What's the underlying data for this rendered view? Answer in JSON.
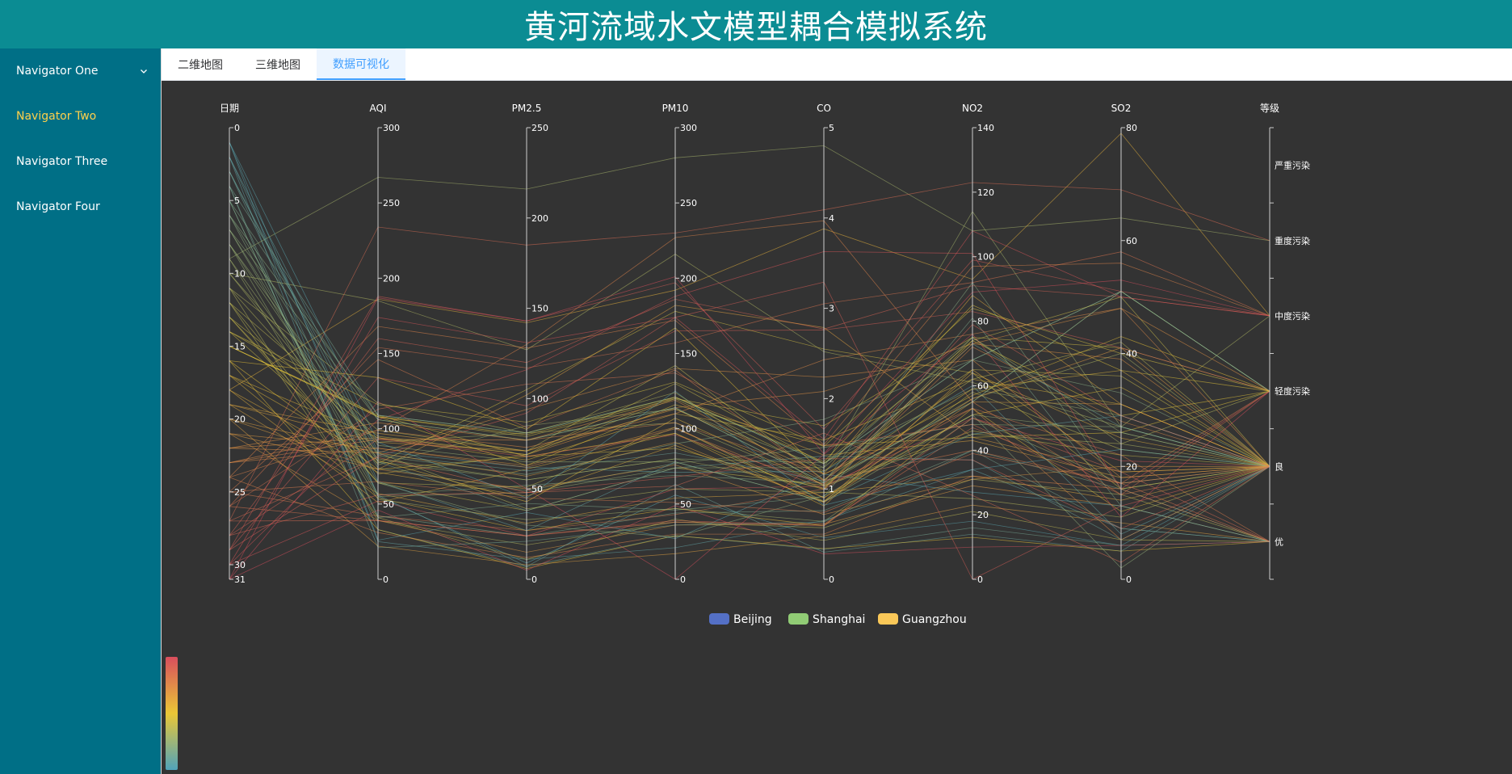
{
  "header": {
    "title": "黄河流域水文模型耦合模拟系统"
  },
  "sidebar": {
    "items": [
      {
        "label": "Navigator One",
        "icon": "chevron-down-icon",
        "active": false
      },
      {
        "label": "Navigator Two",
        "active": true
      },
      {
        "label": "Navigator Three",
        "active": false
      },
      {
        "label": "Navigator Four",
        "active": false
      }
    ]
  },
  "tabs": [
    {
      "label": "二维地图",
      "active": false
    },
    {
      "label": "三维地图",
      "active": false
    },
    {
      "label": "数据可视化",
      "active": true
    }
  ],
  "colors": {
    "header_bg": "#0b8c93",
    "sidebar_bg": "#006f86",
    "active_nav": "#ffd04b",
    "active_tab": "#409eff",
    "chart_bg": "#333333",
    "visualmap": [
      "#50a3ba",
      "#eac736",
      "#d94e5d"
    ]
  },
  "chart_data": {
    "type": "parallel",
    "axes": [
      {
        "name": "日期",
        "type": "value",
        "min": 0,
        "max": 31,
        "ticks": [
          0,
          5,
          10,
          15,
          20,
          25,
          30,
          31
        ],
        "inverse": true
      },
      {
        "name": "AQI",
        "type": "value",
        "min": 0,
        "max": 300,
        "ticks": [
          0,
          50,
          100,
          150,
          200,
          250,
          300
        ]
      },
      {
        "name": "PM2.5",
        "type": "value",
        "min": 0,
        "max": 250,
        "ticks": [
          0,
          50,
          100,
          150,
          200,
          250
        ]
      },
      {
        "name": "PM10",
        "type": "value",
        "min": 0,
        "max": 300,
        "ticks": [
          0,
          50,
          100,
          150,
          200,
          250,
          300
        ]
      },
      {
        "name": "CO",
        "type": "value",
        "min": 0,
        "max": 5,
        "ticks": [
          0,
          1,
          2,
          3,
          4,
          5
        ]
      },
      {
        "name": "NO2",
        "type": "value",
        "min": 0,
        "max": 140,
        "ticks": [
          0,
          20,
          40,
          60,
          80,
          100,
          120,
          140
        ]
      },
      {
        "name": "SO2",
        "type": "value",
        "min": 0,
        "max": 80,
        "ticks": [
          0,
          20,
          40,
          60,
          80
        ]
      },
      {
        "name": "等级",
        "type": "category",
        "categories": [
          "严重污染",
          "重度污染",
          "中度污染",
          "轻度污染",
          "良",
          "优"
        ]
      }
    ],
    "legend": [
      "Beijing",
      "Shanghai",
      "Guangzhou"
    ],
    "legend_colors": [
      "#5470c6",
      "#91cc75",
      "#fac858"
    ],
    "legend_position": "bottom-center",
    "visual_map": {
      "dimension": "日期",
      "min": 0,
      "max": 31,
      "colors": [
        "#50a3ba",
        "#eac736",
        "#d94e5d"
      ],
      "position": "bottom-left"
    },
    "series": [
      {
        "name": "Beijing",
        "data": [
          [
            1,
            55,
            9,
            56,
            0.46,
            18,
            6,
            "良"
          ],
          [
            2,
            25,
            11,
            21,
            0.65,
            34,
            9,
            "优"
          ],
          [
            3,
            56,
            7,
            63,
            0.3,
            14,
            5,
            "良"
          ],
          [
            4,
            33,
            7,
            29,
            0.33,
            16,
            6,
            "优"
          ],
          [
            5,
            42,
            24,
            44,
            0.76,
            40,
            16,
            "优"
          ],
          [
            6,
            82,
            58,
            90,
            1.77,
            68,
            33,
            "良"
          ],
          [
            7,
            74,
            49,
            77,
            1.46,
            48,
            27,
            "良"
          ],
          [
            8,
            78,
            55,
            80,
            1.29,
            59,
            29,
            "良"
          ],
          [
            9,
            267,
            216,
            280,
            4.8,
            108,
            64,
            "重度污染"
          ],
          [
            10,
            185,
            127,
            216,
            2.52,
            61,
            27,
            "中度污染"
          ],
          [
            11,
            39,
            19,
            38,
            0.57,
            31,
            15,
            "优"
          ],
          [
            12,
            41,
            11,
            40,
            0.43,
            21,
            7,
            "优"
          ],
          [
            13,
            64,
            38,
            74,
            1.04,
            46,
            22,
            "良"
          ],
          [
            14,
            108,
            79,
            120,
            1.7,
            75,
            41,
            "轻度污染"
          ],
          [
            15,
            108,
            63,
            116,
            1.48,
            44,
            26,
            "轻度污染"
          ],
          [
            16,
            33,
            6,
            29,
            0.34,
            13,
            5,
            "优"
          ],
          [
            17,
            94,
            66,
            110,
            1.54,
            62,
            31,
            "良"
          ],
          [
            18,
            186,
            142,
            192,
            3.88,
            93,
            79,
            "中度污染"
          ],
          [
            19,
            57,
            31,
            54,
            0.96,
            32,
            14,
            "良"
          ],
          [
            20,
            22,
            8,
            17,
            0.48,
            23,
            10,
            "优"
          ],
          [
            21,
            39,
            15,
            36,
            0.61,
            29,
            13,
            "优"
          ],
          [
            22,
            94,
            69,
            114,
            2.08,
            73,
            39,
            "良"
          ],
          [
            23,
            99,
            73,
            110,
            2.43,
            76,
            48,
            "良"
          ],
          [
            24,
            31,
            12,
            30,
            0.5,
            32,
            16,
            "优"
          ],
          [
            25,
            42,
            27,
            43,
            1,
            53,
            22,
            "优"
          ],
          [
            26,
            154,
            117,
            157,
            3.05,
            92,
            58,
            "中度污染"
          ],
          [
            27,
            234,
            185,
            230,
            4.09,
            123,
            69,
            "重度污染"
          ],
          [
            28,
            160,
            120,
            186,
            2.77,
            91,
            50,
            "中度污染"
          ],
          [
            29,
            134,
            96,
            165,
            2.76,
            83,
            41,
            "轻度污染"
          ],
          [
            30,
            52,
            24,
            60,
            1.03,
            50,
            21,
            "良"
          ],
          [
            31,
            46,
            5,
            49,
            0.28,
            10,
            6,
            "优"
          ]
        ]
      },
      {
        "name": "Shanghai",
        "data": [
          [
            1,
            26,
            37,
            27,
            1.163,
            27,
            13,
            "优"
          ],
          [
            2,
            85,
            62,
            71,
            1.195,
            60,
            8,
            "良"
          ],
          [
            3,
            78,
            38,
            74,
            1.363,
            37,
            7,
            "良"
          ],
          [
            4,
            21,
            21,
            36,
            0.634,
            40,
            9,
            "优"
          ],
          [
            5,
            41,
            42,
            46,
            0.915,
            81,
            13,
            "优"
          ],
          [
            6,
            56,
            52,
            69,
            1.067,
            92,
            16,
            "良"
          ],
          [
            7,
            64,
            30,
            28,
            0.924,
            51,
            2,
            "良"
          ],
          [
            8,
            55,
            48,
            74,
            1.236,
            75,
            26,
            "良"
          ],
          [
            9,
            76,
            85,
            113,
            1.237,
            114,
            27,
            "良"
          ],
          [
            10,
            91,
            81,
            104,
            1.041,
            56,
            40,
            "良"
          ],
          [
            11,
            84,
            39,
            60,
            0.964,
            25,
            11,
            "良"
          ],
          [
            12,
            64,
            51,
            101,
            0.862,
            58,
            23,
            "良"
          ],
          [
            13,
            70,
            69,
            120,
            1.198,
            65,
            36,
            "良"
          ],
          [
            14,
            77,
            105,
            178,
            2.549,
            64,
            16,
            "良"
          ],
          [
            15,
            109,
            68,
            87,
            0.996,
            74,
            29,
            "轻度污染"
          ],
          [
            16,
            73,
            68,
            97,
            0.905,
            51,
            34,
            "良"
          ],
          [
            17,
            54,
            27,
            47,
            0.592,
            53,
            12,
            "良"
          ],
          [
            18,
            51,
            61,
            97,
            0.811,
            65,
            19,
            "良"
          ],
          [
            19,
            91,
            71,
            121,
            1.374,
            43,
            18,
            "良"
          ],
          [
            20,
            73,
            102,
            182,
            2.787,
            44,
            19,
            "良"
          ],
          [
            21,
            73,
            50,
            76,
            0.717,
            31,
            20,
            "良"
          ],
          [
            22,
            84,
            94,
            140,
            2.238,
            68,
            18,
            "良"
          ],
          [
            23,
            93,
            77,
            104,
            1.165,
            53,
            7,
            "良"
          ],
          [
            24,
            99,
            130,
            227,
            3.97,
            55,
            15,
            "良"
          ],
          [
            25,
            146,
            84,
            139,
            1.094,
            40,
            17,
            "轻度污染"
          ],
          [
            26,
            113,
            108,
            137,
            1.481,
            48,
            15,
            "轻度污染"
          ],
          [
            27,
            81,
            48,
            62,
            1.619,
            26,
            3,
            "良"
          ],
          [
            28,
            56,
            48,
            68,
            1.336,
            37,
            9,
            "良"
          ],
          [
            29,
            82,
            92,
            174,
            3.29,
            0,
            13,
            "良"
          ],
          [
            30,
            106,
            116,
            188,
            3.628,
            101,
            16,
            "轻度污染"
          ],
          [
            31,
            118,
            50,
            0,
            1.383,
            76,
            11,
            "轻度污染"
          ]
        ]
      },
      {
        "name": "Guangzhou",
        "data": [
          [
            1,
            91,
            45,
            125,
            0.82,
            34,
            23,
            "良"
          ],
          [
            2,
            65,
            27,
            78,
            0.86,
            45,
            29,
            "良"
          ],
          [
            3,
            83,
            60,
            84,
            1.09,
            73,
            27,
            "良"
          ],
          [
            4,
            109,
            81,
            121,
            1.28,
            68,
            51,
            "轻度污染"
          ],
          [
            5,
            106,
            77,
            114,
            1.07,
            55,
            51,
            "轻度污染"
          ],
          [
            6,
            109,
            81,
            121,
            1.28,
            68,
            51,
            "轻度污染"
          ],
          [
            7,
            106,
            77,
            114,
            1.07,
            55,
            51,
            "轻度污染"
          ],
          [
            8,
            89,
            65,
            78,
            0.86,
            51,
            26,
            "良"
          ],
          [
            9,
            53,
            33,
            47,
            0.64,
            50,
            17,
            "良"
          ],
          [
            10,
            80,
            55,
            80,
            1.01,
            75,
            24,
            "良"
          ],
          [
            11,
            117,
            81,
            124,
            1.03,
            45,
            24,
            "轻度污染"
          ],
          [
            12,
            99,
            71,
            142,
            1.1,
            62,
            42,
            "良"
          ],
          [
            13,
            95,
            69,
            130,
            1.28,
            74,
            50,
            "良"
          ],
          [
            14,
            116,
            87,
            131,
            1.47,
            84,
            40,
            "轻度污染"
          ],
          [
            15,
            108,
            80,
            121,
            1.3,
            85,
            37,
            "轻度污染"
          ],
          [
            16,
            134,
            83,
            167,
            1.16,
            57,
            43,
            "轻度污染"
          ],
          [
            17,
            79,
            43,
            107,
            1.05,
            59,
            37,
            "良"
          ],
          [
            18,
            71,
            46,
            89,
            0.86,
            64,
            25,
            "良"
          ],
          [
            19,
            97,
            71,
            113,
            1.17,
            88,
            31,
            "良"
          ],
          [
            20,
            84,
            57,
            91,
            0.85,
            55,
            31,
            "良"
          ],
          [
            21,
            87,
            63,
            101,
            0.9,
            56,
            41,
            "良"
          ],
          [
            22,
            104,
            77,
            119,
            1.09,
            73,
            48,
            "轻度污染"
          ],
          [
            23,
            87,
            62,
            100,
            1,
            72,
            28,
            "良"
          ],
          [
            24,
            168,
            128,
            172,
            1.49,
            97,
            56,
            "中度污染"
          ],
          [
            25,
            65,
            45,
            51,
            0.74,
            39,
            17,
            "良"
          ],
          [
            26,
            39,
            24,
            38,
            0.61,
            47,
            17,
            "优"
          ],
          [
            27,
            39,
            24,
            39,
            0.59,
            50,
            19,
            "优"
          ],
          [
            28,
            93,
            68,
            96,
            1.05,
            79,
            29,
            "良"
          ],
          [
            29,
            188,
            143,
            197,
            1.66,
            99,
            51,
            "中度污染"
          ],
          [
            30,
            174,
            131,
            174,
            1.55,
            108,
            50,
            "中度污染"
          ],
          [
            31,
            187,
            143,
            201,
            1.39,
            89,
            53,
            "中度污染"
          ]
        ]
      }
    ]
  }
}
